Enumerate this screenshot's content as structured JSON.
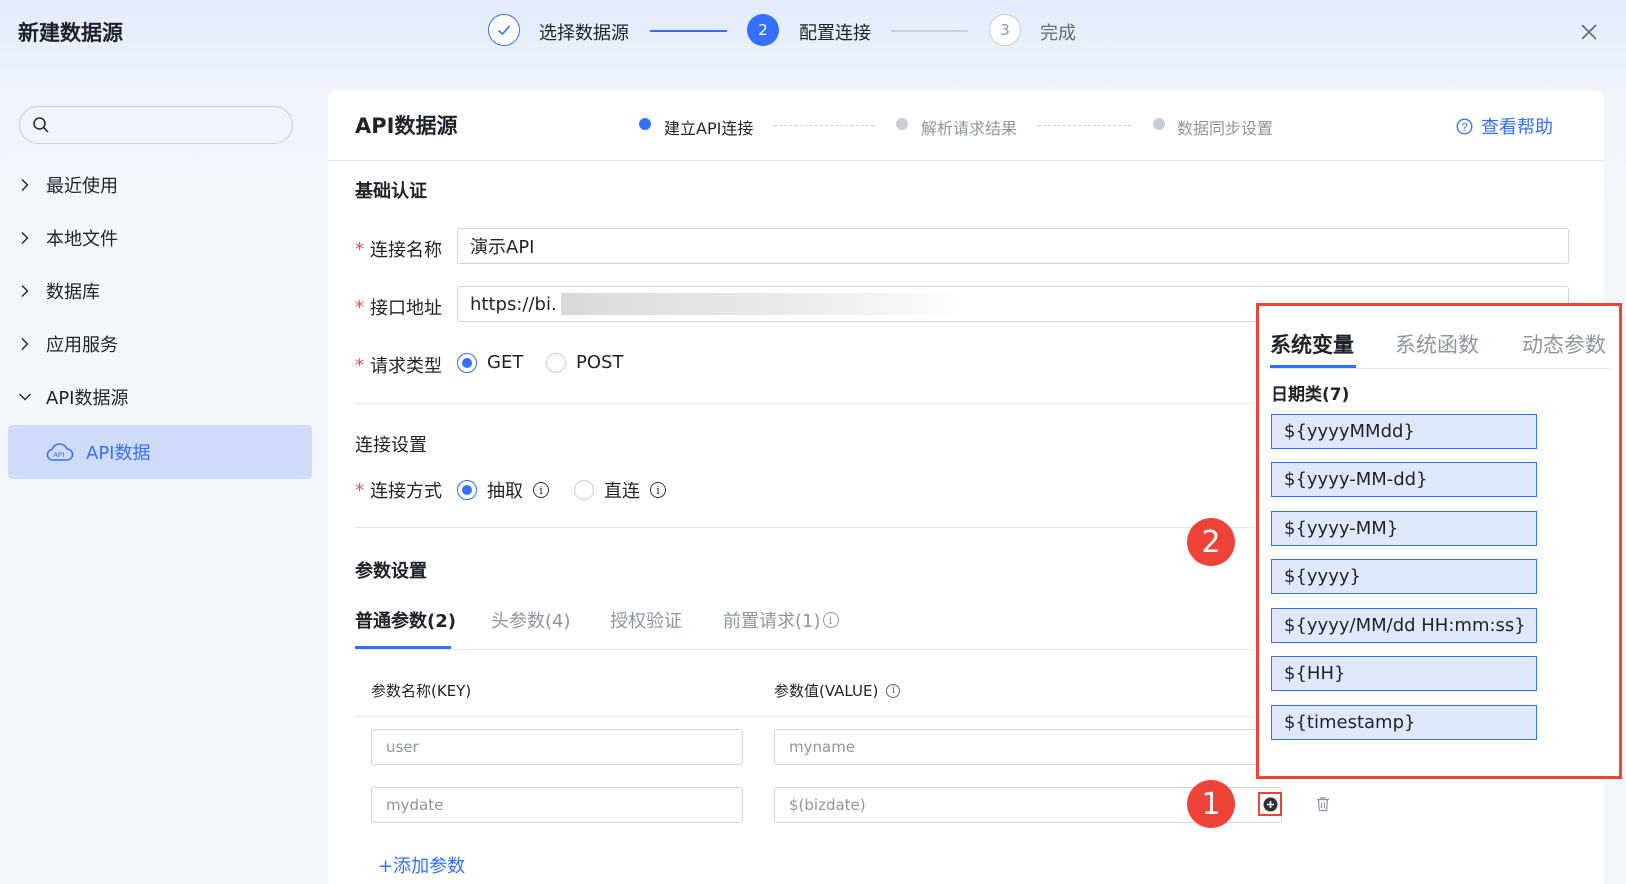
{
  "header": {
    "title": "新建数据源",
    "steps": [
      {
        "num": "",
        "label": "选择数据源"
      },
      {
        "num": "2",
        "label": "配置连接"
      },
      {
        "num": "3",
        "label": "完成"
      }
    ]
  },
  "sidebar": {
    "search_placeholder": "",
    "items": [
      {
        "label": "最近使用"
      },
      {
        "label": "本地文件"
      },
      {
        "label": "数据库"
      },
      {
        "label": "应用服务"
      },
      {
        "label": "API数据源"
      }
    ],
    "active_child": "API数据"
  },
  "main": {
    "title": "API数据源",
    "substeps": [
      "建立API连接",
      "解析请求结果",
      "数据同步设置"
    ],
    "help": "查看帮助",
    "basic_auth": "基础认证",
    "fields": {
      "name_label": "连接名称",
      "name_value": "演示API",
      "url_label": "接口地址",
      "url_value": "https://bi.",
      "method_label": "请求类型",
      "method_get": "GET",
      "method_post": "POST"
    },
    "conn_settings": "连接设置",
    "conn_mode_label": "连接方式",
    "conn_extract": "抽取",
    "conn_direct": "直连",
    "params_title": "参数设置",
    "tabs": [
      "普通参数(2)",
      "头参数(4)",
      "授权验证",
      "前置请求(1)"
    ],
    "col_key": "参数名称(KEY)",
    "col_value": "参数值(VALUE)",
    "rows": [
      {
        "key": "user",
        "value": "myname"
      },
      {
        "key": "mydate",
        "value": "$(bizdate)"
      }
    ],
    "add_param": "+添加参数"
  },
  "markers": [
    "1",
    "2"
  ],
  "popup": {
    "tabs": [
      "系统变量",
      "系统函数",
      "动态参数"
    ],
    "group": "日期类(7)",
    "vars": [
      "${yyyyMMdd}",
      "${yyyy-MM-dd}",
      "${yyyy-MM}",
      "${yyyy}",
      "${yyyy/MM/dd HH:mm:ss}",
      "${HH}",
      "${timestamp}"
    ]
  },
  "colors": {
    "accent": "#3370ff",
    "marker": "#f04337",
    "required": "#f54a45"
  }
}
